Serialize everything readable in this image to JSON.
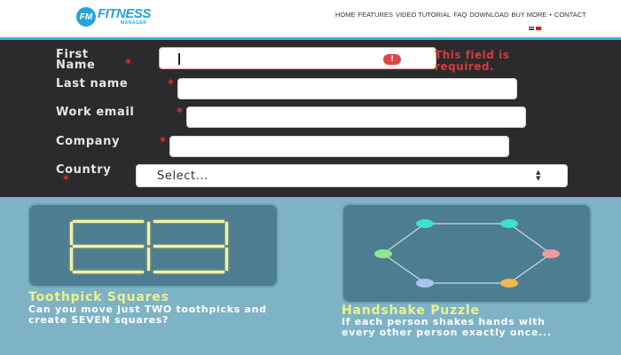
{
  "header": {
    "logo": {
      "badge": "FM",
      "word": "FITNESS",
      "sub": "MANAGER"
    },
    "nav": [
      "HOME",
      "FEATURES",
      "VIDEO TUTORIAL",
      "FAQ",
      "DOWNLOAD",
      "BUY MORE",
      "•",
      "CONTACT"
    ]
  },
  "form": {
    "first_name": {
      "label": "First Name",
      "required": "*",
      "error": "This field is required."
    },
    "last_name": {
      "label": "Last name",
      "required": "*"
    },
    "work_email": {
      "label": "Work email",
      "required": "*"
    },
    "company": {
      "label": "Company",
      "required": "*"
    },
    "country": {
      "label": "Country",
      "required": "*",
      "selected": "Select..."
    }
  },
  "puzzles": [
    {
      "title": "Toothpick Squares",
      "description": "Can you move just TWO toothpicks and create SEVEN squares?"
    },
    {
      "title": "Handshake Puzzle",
      "description": "If each person shakes hands with every other person exactly once..."
    }
  ],
  "colors": {
    "header_accent": "#3fb5d6",
    "form_bg": "#2b2b2e",
    "error": "#e03030",
    "puzzle_bg": "#7eb3c6",
    "card_bg": "#4d7d90",
    "puzzle_title": "#eef089",
    "node_colors": [
      "#3ee0c8",
      "#3ee0c8",
      "#f29a9a",
      "#f0b84a",
      "#a9c4f2",
      "#8ee88e"
    ]
  }
}
